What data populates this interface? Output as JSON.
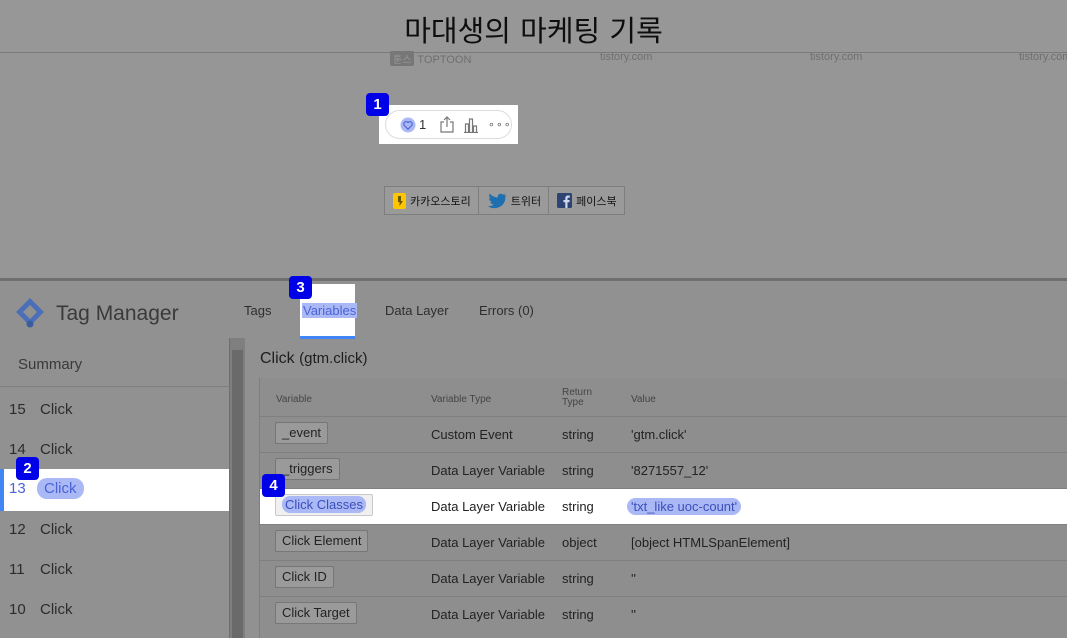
{
  "blog": {
    "title": "마대생의 마케팅 기록",
    "ads": [
      {
        "badge": "툰스",
        "text": "TOPTOON"
      },
      {
        "text": "tistory.com"
      },
      {
        "text": "tistory.com"
      },
      {
        "text": "tistory.com"
      }
    ],
    "like_count": "1",
    "more": "∘∘∘",
    "social": [
      {
        "label": "카카오스토리",
        "icon": "kakaostory-icon",
        "color": "#ffc600"
      },
      {
        "label": "트위터",
        "icon": "twitter-icon",
        "color": "#1da1f2"
      },
      {
        "label": "페이스북",
        "icon": "facebook-icon",
        "color": "#3b5998"
      }
    ]
  },
  "markers": [
    "1",
    "2",
    "3",
    "4"
  ],
  "tag_manager": {
    "name": "Tag Manager",
    "tabs": [
      "Tags",
      "Variables",
      "Data Layer",
      "Errors (0)"
    ],
    "active_tab": "Variables",
    "summary": "Summary",
    "events": [
      {
        "num": "15",
        "label": "Click"
      },
      {
        "num": "14",
        "label": "Click"
      },
      {
        "num": "13",
        "label": "Click",
        "selected": true
      },
      {
        "num": "12",
        "label": "Click"
      },
      {
        "num": "11",
        "label": "Click"
      },
      {
        "num": "10",
        "label": "Click"
      }
    ],
    "detail_title": "Click",
    "detail_subtitle": "(gtm.click)",
    "columns": [
      "Variable",
      "Variable Type",
      "Return Type",
      "Value"
    ],
    "rows": [
      {
        "variable": "_event",
        "type": "Custom Event",
        "return": "string",
        "value": "'gtm.click'"
      },
      {
        "variable": "_triggers",
        "type": "Data Layer Variable",
        "return": "string",
        "value": "'8271557_12'"
      },
      {
        "variable": "Click Classes",
        "type": "Data Layer Variable",
        "return": "string",
        "value": "'txt_like uoc-count'",
        "selected": true
      },
      {
        "variable": "Click Element",
        "type": "Data Layer Variable",
        "return": "object",
        "value": "[object HTMLSpanElement]"
      },
      {
        "variable": "Click ID",
        "type": "Data Layer Variable",
        "return": "string",
        "value": "''"
      },
      {
        "variable": "Click Target",
        "type": "Data Layer Variable",
        "return": "string",
        "value": "''"
      }
    ]
  },
  "colors": {
    "accent": "#4285f4",
    "highlight": "#aab8f5",
    "marker": "#0000e8"
  }
}
